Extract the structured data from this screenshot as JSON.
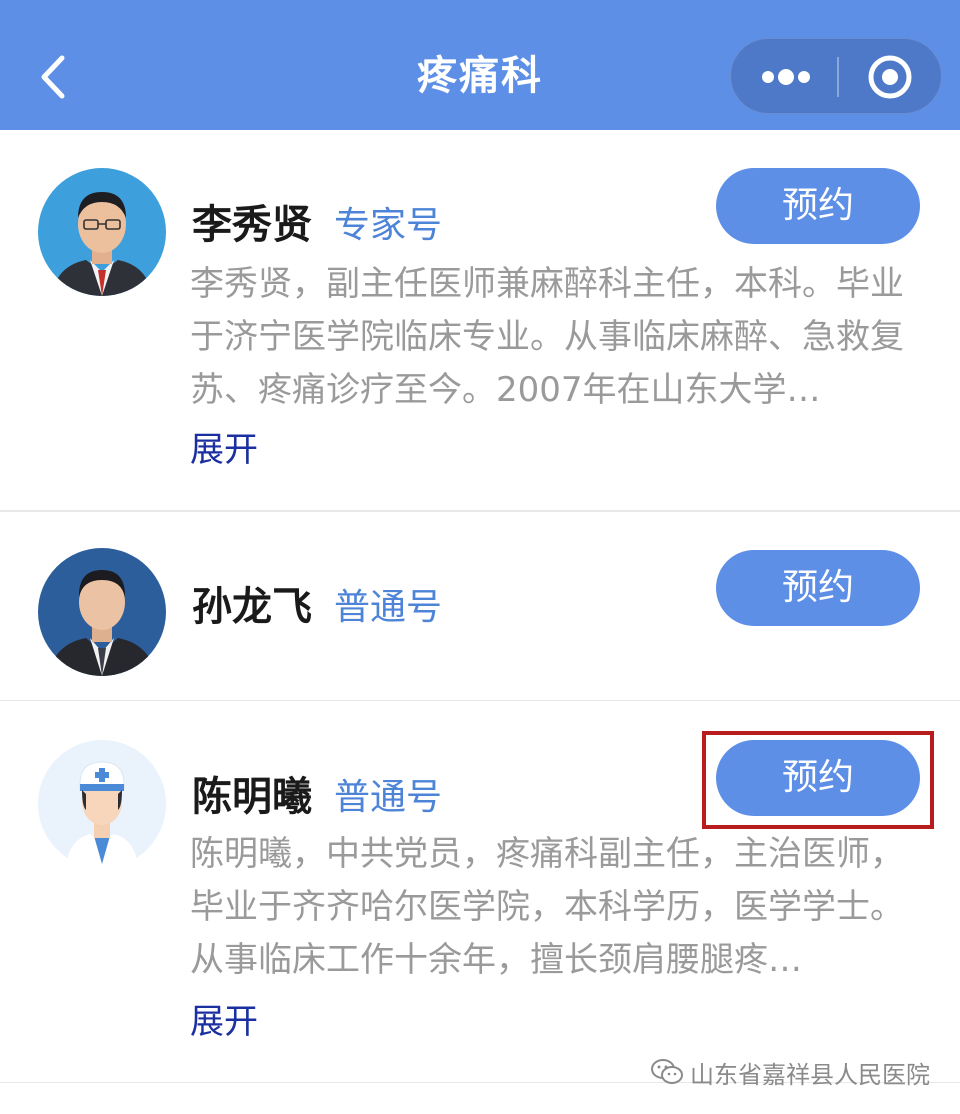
{
  "header": {
    "title": "疼痛科",
    "back_icon": "chevron-left-icon",
    "more_icon": "more-dots-icon",
    "close_icon": "target-circle-icon",
    "background": "#5e8fe6"
  },
  "doctors": [
    {
      "name": "李秀贤",
      "type": "专家号",
      "button": "预约",
      "description": "李秀贤，副主任医师兼麻醉科主任，本科。毕业于济宁医学院临床专业。从事临床麻醉、急救复苏、疼痛诊疗至今。2007年在山东大学…",
      "expand": "展开"
    },
    {
      "name": "孙龙飞",
      "type": "普通号",
      "button": "预约"
    },
    {
      "name": "陈明曦",
      "type": "普通号",
      "button": "预约",
      "description": "陈明曦，中共党员，疼痛科副主任，主治医师，毕业于齐齐哈尔医学院，本科学历，医学学士。从事临床工作十余年，擅长颈肩腰腿疼…",
      "expand": "展开"
    }
  ],
  "watermark": {
    "text": "山东省嘉祥县人民医院"
  },
  "colors": {
    "accent": "#5e8fe6",
    "type_text": "#4d84d8",
    "expand_text": "#1b2fa0",
    "highlight": "#b81c1c"
  }
}
